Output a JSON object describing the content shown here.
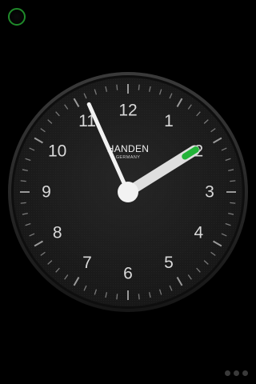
{
  "clock": {
    "numerals": [
      "12",
      "1",
      "2",
      "3",
      "4",
      "5",
      "6",
      "7",
      "8",
      "9",
      "10",
      "11"
    ],
    "brand": "HANDEN",
    "brand_sub": "GERMANY",
    "time": {
      "hour": 1,
      "minute": 56
    },
    "colors": {
      "face": "#1c1c1c",
      "bezel": "#2a2a2a",
      "hands": "#f2f2f2",
      "tip_accent": "#22b338"
    }
  },
  "top_button": {
    "icon": "circle-outline-icon",
    "color": "#1f8a2a"
  },
  "page_indicator": {
    "count": 3,
    "active": 0
  }
}
